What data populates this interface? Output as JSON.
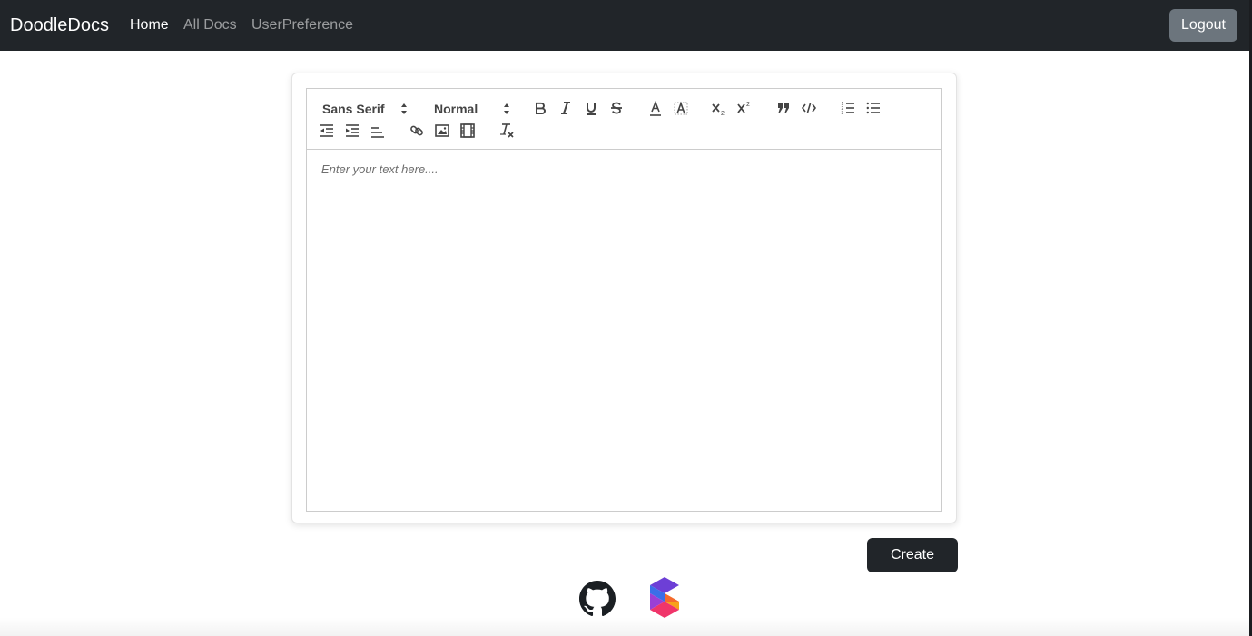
{
  "navbar": {
    "brand": "DoodleDocs",
    "links": [
      {
        "label": "Home",
        "active": true
      },
      {
        "label": "All Docs",
        "active": false
      },
      {
        "label": "UserPreference",
        "active": false
      }
    ],
    "logout_label": "Logout",
    "background": "#212529"
  },
  "toolbar": {
    "font_picker": "Sans Serif",
    "size_picker": "Normal",
    "buttons": [
      "bold-icon",
      "italic-icon",
      "underline-icon",
      "strikethrough-icon",
      "text-color-icon",
      "background-color-icon",
      "subscript-icon",
      "superscript-icon",
      "blockquote-icon",
      "code-block-icon",
      "ordered-list-icon",
      "bullet-list-icon",
      "outdent-icon",
      "indent-icon",
      "align-icon",
      "link-icon",
      "image-icon",
      "video-icon",
      "clear-format-icon"
    ]
  },
  "editor": {
    "placeholder": "Enter your text here...."
  },
  "actions": {
    "create_label": "Create"
  },
  "footer": {
    "icons": [
      "github-icon",
      "app-logo-icon"
    ]
  }
}
